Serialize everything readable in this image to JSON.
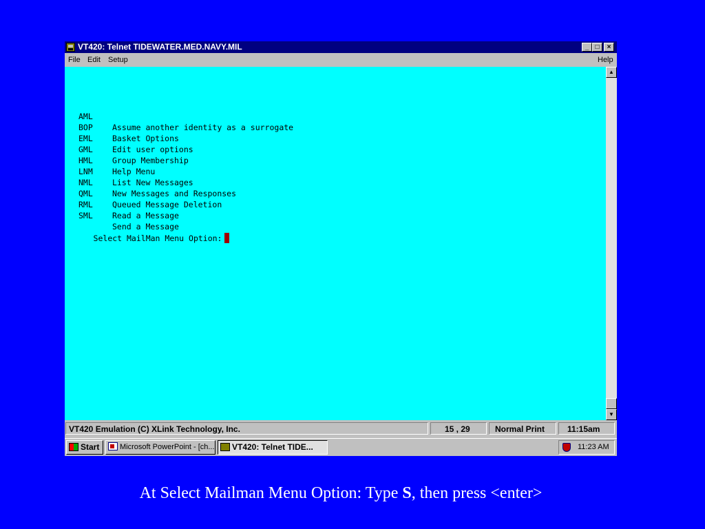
{
  "window": {
    "title": "VT420: Telnet TIDEWATER.MED.NAVY.MIL",
    "min_glyph": "_",
    "max_glyph": "□",
    "close_glyph": "×"
  },
  "menubar": {
    "file": "File",
    "edit": "Edit",
    "setup": "Setup",
    "help": "Help"
  },
  "terminal": {
    "options": [
      {
        "code": "AML",
        "desc": "Assume another identity as a surrogate"
      },
      {
        "code": "BOP",
        "desc": "Basket Options"
      },
      {
        "code": "EML",
        "desc": "Edit user options"
      },
      {
        "code": "GML",
        "desc": "Group Membership"
      },
      {
        "code": "HML",
        "desc": "Help Menu"
      },
      {
        "code": "LNM",
        "desc": "List New Messages"
      },
      {
        "code": "NML",
        "desc": "New Messages and Responses"
      },
      {
        "code": "QML",
        "desc": "Queued Message Deletion"
      },
      {
        "code": "RML",
        "desc": "Read a Message"
      },
      {
        "code": "SML",
        "desc": "Send a Message"
      }
    ],
    "prompt": "Select MailMan Menu Option:"
  },
  "statusbar": {
    "emulation": "VT420 Emulation (C) XLink Technology, Inc.",
    "position": "15 , 29",
    "mode": "Normal Print",
    "time": "11:15am"
  },
  "taskbar": {
    "start": "Start",
    "tasks": [
      {
        "label": "Microsoft PowerPoint - [ch...",
        "icon": "powerpoint-icon"
      },
      {
        "label": "VT420: Telnet TIDE...",
        "icon": "vt420-icon"
      }
    ],
    "tray_time": "11:23 AM"
  },
  "caption": {
    "before": "At Select Mailman Menu Option: Type ",
    "key": "S",
    "after": ", then press <enter>"
  },
  "colors": {
    "background": "#0000FF",
    "terminal_bg": "#00FFFF",
    "titlebar": "#000080",
    "cursor": "#A00000"
  }
}
